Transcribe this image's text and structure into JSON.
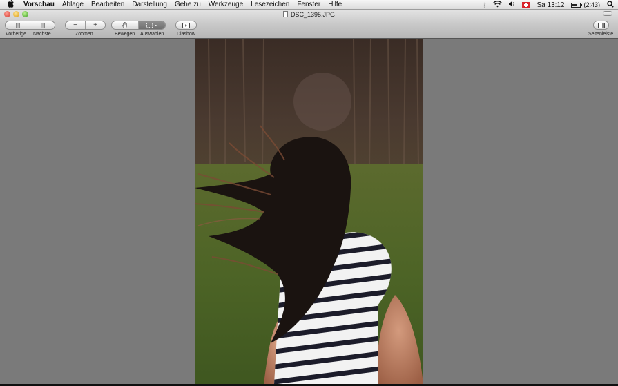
{
  "menubar": {
    "app_name": "Vorschau",
    "menus": [
      "Ablage",
      "Bearbeiten",
      "Darstellung",
      "Gehe zu",
      "Werkzeuge",
      "Lesezeichen",
      "Fenster",
      "Hilfe"
    ],
    "clock": "Sa 13:12",
    "battery": "(2:43)",
    "battery_level": 0.7
  },
  "window": {
    "title": "DSC_1395.JPG"
  },
  "toolbar": {
    "prev_label": "Vorherige",
    "next_label": "Nächste",
    "zoom_label": "Zoomen",
    "zoom_out_symbol": "−",
    "zoom_in_symbol": "+",
    "move_label": "Bewegen",
    "select_label": "Auswählen",
    "slideshow_label": "Diashow",
    "sidebar_label": "Seitenleiste"
  },
  "icons": {
    "apple": "apple-logo-icon",
    "wifi": "wifi-icon",
    "volume": "volume-icon",
    "flag": "swiss-flag-icon",
    "battery": "battery-icon",
    "spotlight": "spotlight-search-icon"
  },
  "colors": {
    "viewer_background": "#7a7a7a",
    "close": "#d13a2f",
    "minimize": "#d79a16",
    "maximize": "#3d9b22"
  }
}
